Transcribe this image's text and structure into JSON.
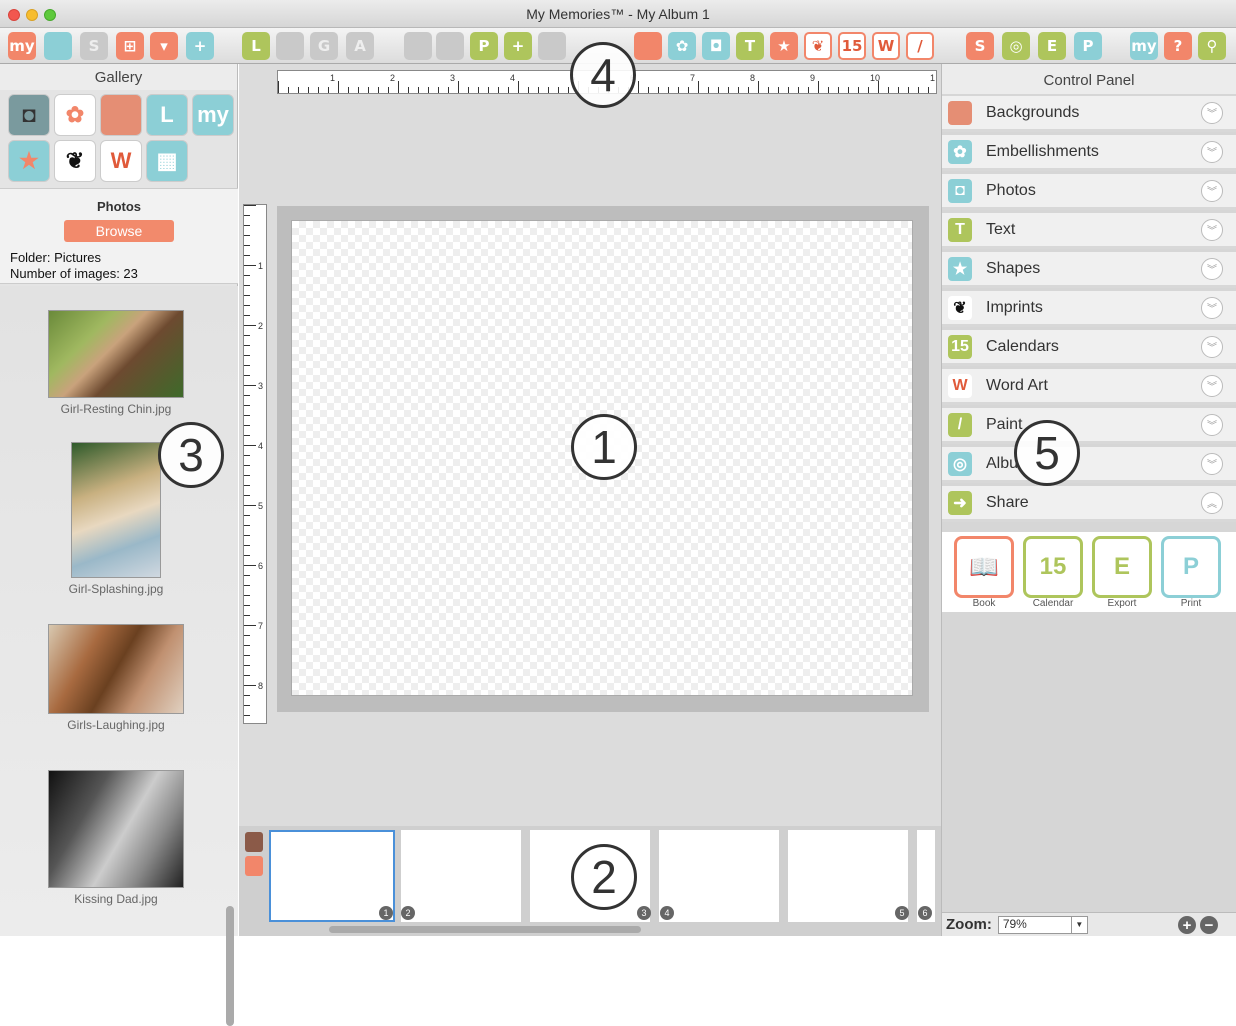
{
  "window": {
    "title": "My Memories™ - My Album 1"
  },
  "toolbar": {
    "items": [
      {
        "icon": "my-logo-icon",
        "label": "my"
      },
      {
        "icon": "folder-icon",
        "label": ""
      },
      {
        "icon": "save-icon",
        "label": "S"
      },
      {
        "icon": "layout-icon",
        "label": "⊞"
      },
      {
        "icon": "shield-icon",
        "label": "▾"
      },
      {
        "icon": "add-page-icon",
        "label": "+"
      },
      {
        "icon": "layers-icon",
        "label": "L"
      },
      {
        "icon": "ruler-icon",
        "label": ""
      },
      {
        "icon": "grid-icon",
        "label": "G"
      },
      {
        "icon": "text-style-icon",
        "label": "A"
      },
      {
        "icon": "copy-icon",
        "label": ""
      },
      {
        "icon": "paste-icon",
        "label": ""
      },
      {
        "icon": "photo-page-icon",
        "label": "P"
      },
      {
        "icon": "add-photo-icon",
        "label": "+"
      },
      {
        "icon": "rotate-icon",
        "label": ""
      },
      {
        "icon": "backgrounds-icon",
        "label": ""
      },
      {
        "icon": "embellishments-icon",
        "label": "✿"
      },
      {
        "icon": "photos-icon",
        "label": "◘"
      },
      {
        "icon": "text-icon",
        "label": "T"
      },
      {
        "icon": "shapes-icon",
        "label": "★"
      },
      {
        "icon": "imprints-icon",
        "label": "❦"
      },
      {
        "icon": "calendar-icon",
        "label": "15"
      },
      {
        "icon": "word-art-icon",
        "label": "W"
      },
      {
        "icon": "paint-icon",
        "label": "/"
      },
      {
        "icon": "share-s-icon",
        "label": "S"
      },
      {
        "icon": "book-icon",
        "label": "◎"
      },
      {
        "icon": "export-icon",
        "label": "E"
      },
      {
        "icon": "print-icon",
        "label": "P"
      },
      {
        "icon": "mycom-icon",
        "label": "my"
      },
      {
        "icon": "help-icon",
        "label": "?"
      },
      {
        "icon": "search-icon",
        "label": "⚲"
      }
    ]
  },
  "callouts": {
    "c1": "1",
    "c2": "2",
    "c3": "3",
    "c4": "4",
    "c5": "5"
  },
  "gallery": {
    "title": "Gallery",
    "icons": [
      {
        "name": "camera-icon",
        "glyph": "◘"
      },
      {
        "name": "flower-icon",
        "glyph": "✿"
      },
      {
        "name": "stripes-icon",
        "glyph": ""
      },
      {
        "name": "l-icon",
        "glyph": "L"
      },
      {
        "name": "mycom-icon",
        "glyph": "my"
      },
      {
        "name": "star-icon",
        "glyph": "★"
      },
      {
        "name": "butterfly-icon",
        "glyph": "❦"
      },
      {
        "name": "word-art-icon",
        "glyph": "W"
      },
      {
        "name": "layout-icon",
        "glyph": "▦"
      }
    ]
  },
  "photos": {
    "title": "Photos",
    "browse": "Browse",
    "folder": "Folder: Pictures",
    "count": "Number of images: 23"
  },
  "thumbs": [
    {
      "caption": "Girl-Resting Chin.jpg"
    },
    {
      "caption": "Girl-Splashing.jpg"
    },
    {
      "caption": "Girls-Laughing.jpg"
    },
    {
      "caption": "Kissing Dad.jpg"
    }
  ],
  "ruler": {
    "top": [
      "1",
      "2",
      "3",
      "4",
      "5",
      "6",
      "7",
      "8",
      "9",
      "10",
      "1"
    ],
    "left": [
      "1",
      "2",
      "3",
      "4",
      "5",
      "6",
      "7",
      "8"
    ]
  },
  "pages": {
    "numbers": [
      "1",
      "2",
      "3",
      "4",
      "5",
      "6"
    ]
  },
  "control_panel": {
    "title": "Control Panel",
    "rows": [
      {
        "label": "Backgrounds",
        "icon": "backgrounds-icon",
        "color": "#e58e74",
        "glyph": ""
      },
      {
        "label": "Embellishments",
        "icon": "embellishments-icon",
        "color": "#8ccfd6",
        "glyph": "✿"
      },
      {
        "label": "Photos",
        "icon": "photos-icon",
        "color": "#8ccfd6",
        "glyph": "◘"
      },
      {
        "label": "Text",
        "icon": "text-icon",
        "color": "#aec55c",
        "glyph": "T"
      },
      {
        "label": "Shapes",
        "icon": "shapes-icon",
        "color": "#8ccfd6",
        "glyph": "★"
      },
      {
        "label": "Imprints",
        "icon": "imprints-icon",
        "color": "#111111",
        "glyph": "❦"
      },
      {
        "label": "Calendars",
        "icon": "calendar-icon",
        "color": "#aec55c",
        "glyph": "15"
      },
      {
        "label": "Word Art",
        "icon": "word-art-icon",
        "color": "#e05a3a",
        "glyph": "W"
      },
      {
        "label": "Paint",
        "icon": "paint-icon",
        "color": "#aec55c",
        "glyph": "/"
      },
      {
        "label": "Albu",
        "icon": "album-icon",
        "color": "#8ccfd6",
        "glyph": "◎"
      },
      {
        "label": "Share",
        "icon": "share-icon",
        "color": "#aec55c",
        "glyph": "➜"
      }
    ]
  },
  "share": [
    {
      "label": "Book",
      "icon": "book-icon",
      "color": "#f2866a",
      "glyph": "📖"
    },
    {
      "label": "Calendar",
      "icon": "calendar-icon",
      "color": "#aec55c",
      "glyph": "15"
    },
    {
      "label": "Export",
      "icon": "export-icon",
      "color": "#aec55c",
      "glyph": "E"
    },
    {
      "label": "Print",
      "icon": "print-icon",
      "color": "#8ccfd6",
      "glyph": "P"
    }
  ],
  "zoom": {
    "label": "Zoom:",
    "value": "79%"
  }
}
